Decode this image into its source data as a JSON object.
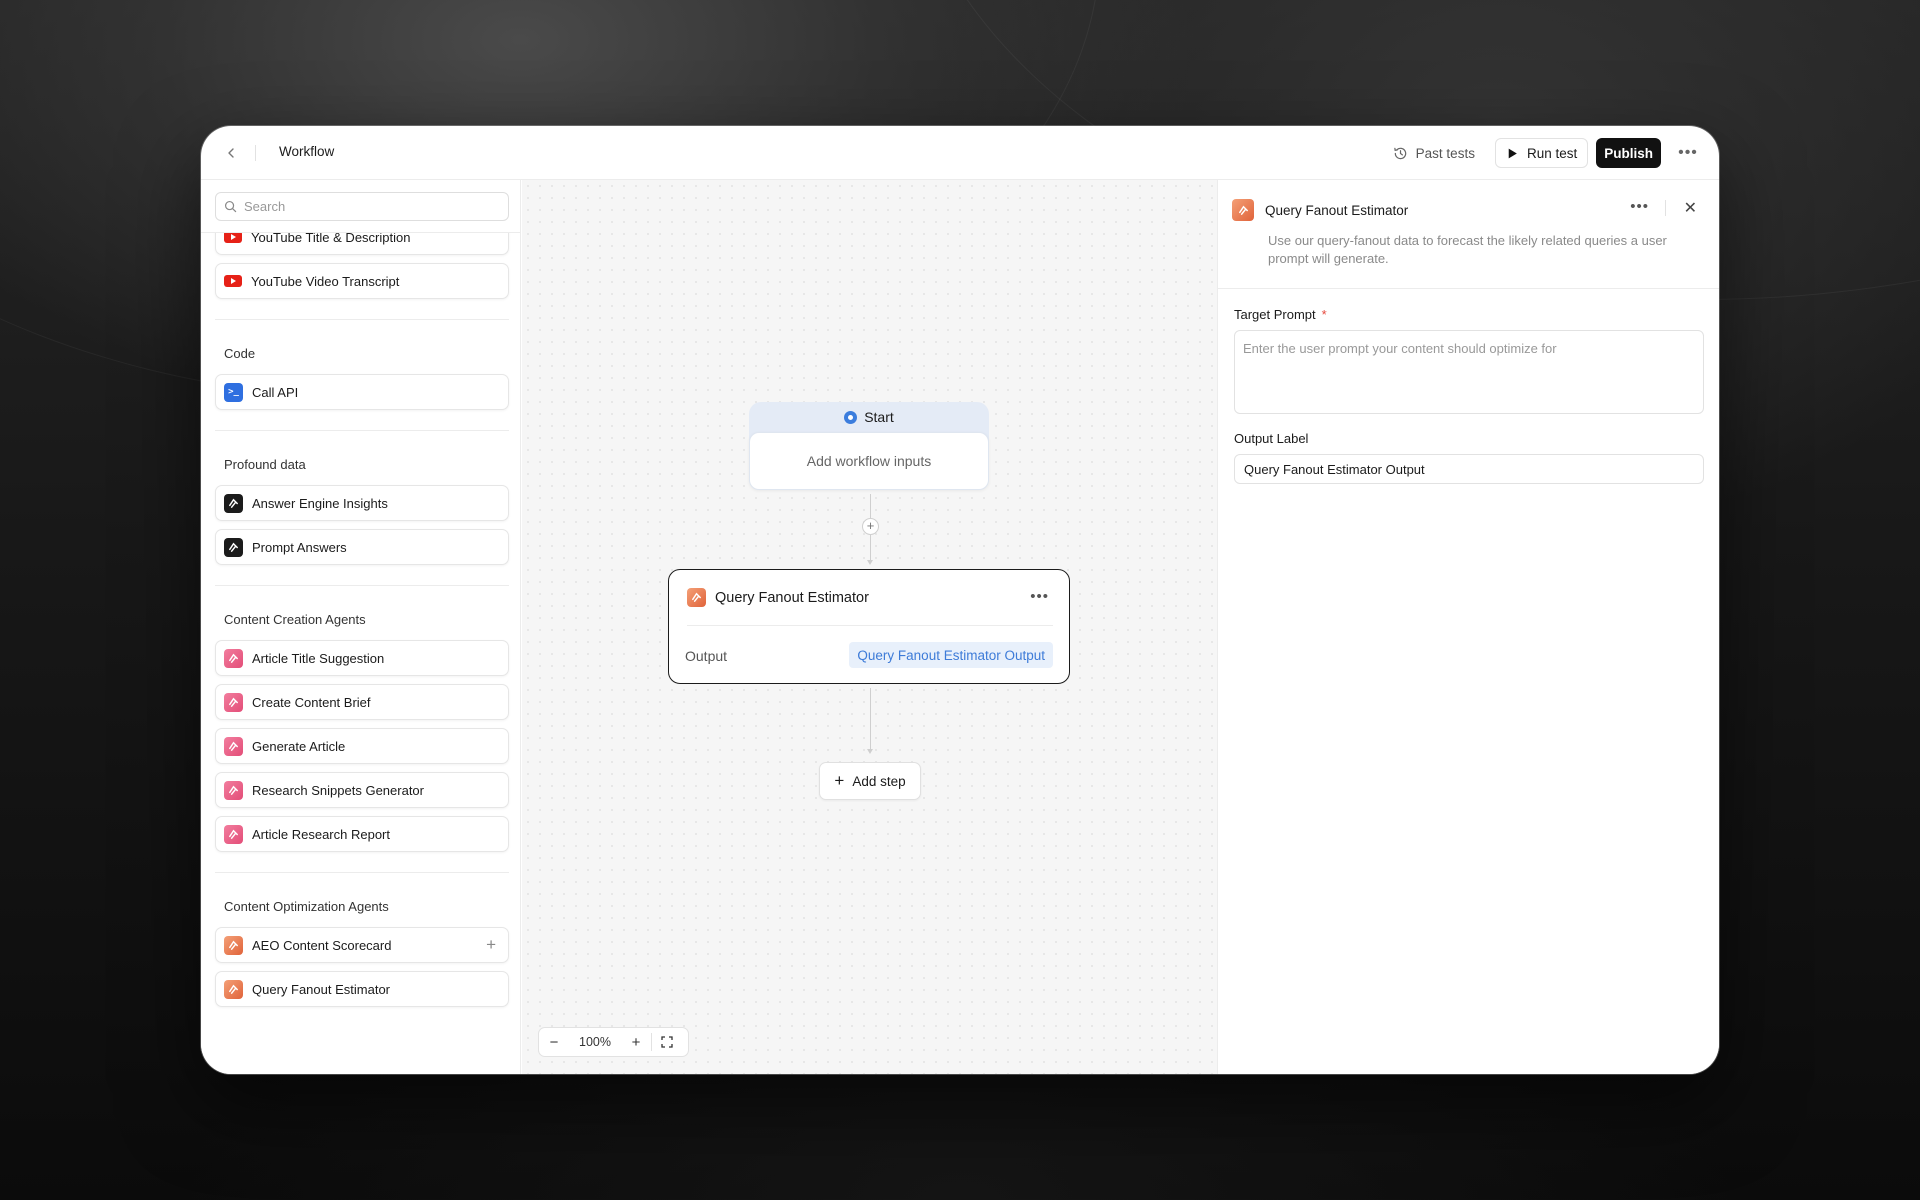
{
  "header": {
    "title": "Workflow",
    "past_tests": "Past tests",
    "run_test": "Run test",
    "publish": "Publish"
  },
  "sidebar": {
    "search_placeholder": "Search",
    "youtube_items": [
      {
        "label": "YouTube Title & Description",
        "icon": "youtube-icon"
      },
      {
        "label": "YouTube Video Transcript",
        "icon": "youtube-icon"
      }
    ],
    "groups": {
      "code": {
        "label": "Code",
        "items": [
          {
            "label": "Call API",
            "icon": "terminal-icon"
          }
        ]
      },
      "profound": {
        "label": "Profound data",
        "items": [
          {
            "label": "Answer Engine Insights",
            "icon": "profound-logo-icon"
          },
          {
            "label": "Prompt Answers",
            "icon": "profound-logo-icon"
          }
        ]
      },
      "creation": {
        "label": "Content Creation Agents",
        "items": [
          {
            "label": "Article Title Suggestion",
            "icon": "agent-icon"
          },
          {
            "label": "Create Content Brief",
            "icon": "agent-icon"
          },
          {
            "label": "Generate Article",
            "icon": "agent-icon"
          },
          {
            "label": "Research Snippets Generator",
            "icon": "agent-icon"
          },
          {
            "label": "Article Research Report",
            "icon": "agent-icon"
          }
        ]
      },
      "optimization": {
        "label": "Content Optimization Agents",
        "items": [
          {
            "label": "AEO Content Scorecard",
            "icon": "agent-icon"
          },
          {
            "label": "Query Fanout Estimator",
            "icon": "agent-icon"
          }
        ]
      }
    },
    "colors": {
      "pink_agent": "#e34d78",
      "orange_agent": "#e0633a",
      "code": "#2f6fe0",
      "youtube": "#e62117"
    }
  },
  "canvas": {
    "start_label": "Start",
    "add_inputs": "Add workflow inputs",
    "step": {
      "title": "Query Fanout Estimator",
      "output_label": "Output",
      "output_value": "Query Fanout Estimator Output"
    },
    "add_step": "Add step",
    "zoom": "100%"
  },
  "panel": {
    "title": "Query Fanout Estimator",
    "description": "Use our query-fanout data to forecast the likely related queries a user prompt will generate.",
    "target_prompt_label": "Target Prompt",
    "required_mark": "*",
    "target_prompt_placeholder": "Enter the user prompt your content should optimize for",
    "output_label": "Output Label",
    "output_value": "Query Fanout Estimator Output"
  }
}
